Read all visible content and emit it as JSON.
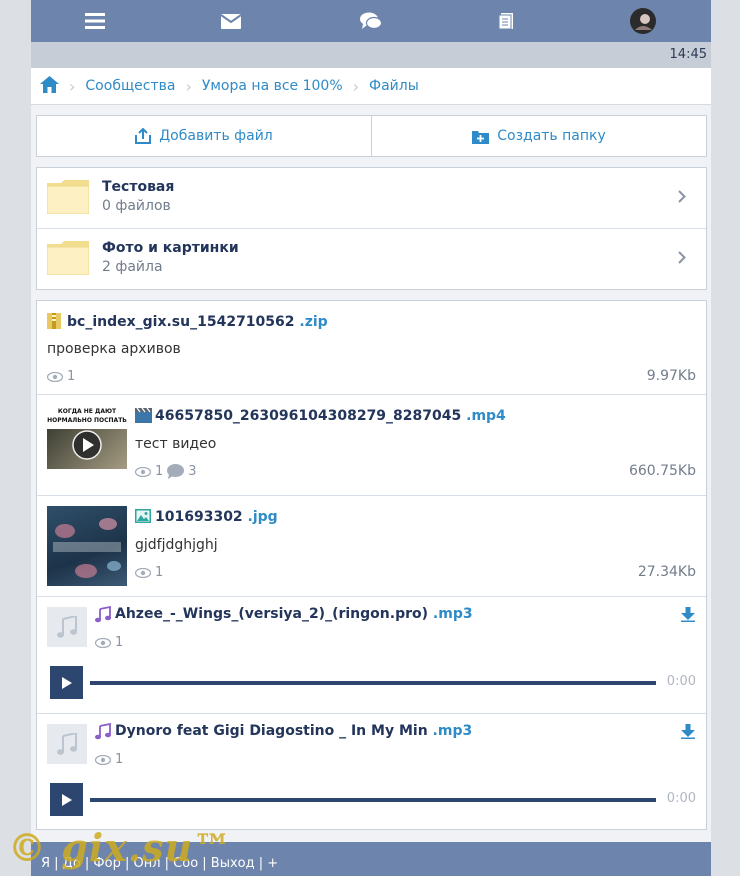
{
  "status": {
    "time": "14:45"
  },
  "nav": {
    "icons": [
      "menu-icon",
      "mail-icon",
      "chat-icon",
      "documents-icon",
      "avatar"
    ]
  },
  "breadcrumb": {
    "items": [
      "Сообщества",
      "Умора на все 100%",
      "Файлы"
    ]
  },
  "actions": {
    "add_file": "Добавить файл",
    "create_folder": "Создать папку"
  },
  "folders": [
    {
      "name": "Тестовая",
      "count": "0 файлов"
    },
    {
      "name": "Фото и картинки",
      "count": "2 файла"
    }
  ],
  "files": [
    {
      "name": "bc_index_gix.su_1542710562",
      "ext": ".zip",
      "desc": "проверка архивов",
      "views": "1",
      "size": "9.97Kb"
    },
    {
      "name": "46657850_263096104308279_8287045",
      "ext": ".mp4",
      "desc": "тест видео",
      "views": "1",
      "comments": "3",
      "size": "660.75Kb",
      "thumb_text": "КОГДА НЕ ДАЮТ НОРМАЛЬНО ПОСПАТЬ"
    },
    {
      "name": "101693302",
      "ext": ".jpg",
      "desc": "gjdfjdghjghj",
      "views": "1",
      "size": "27.34Kb"
    },
    {
      "name": "Ahzee_-_Wings_(versiya_2)_(ringon.pro)",
      "ext": ".mp3",
      "views": "1",
      "time": "0:00"
    },
    {
      "name": "Dynoro feat Gigi Diagostino _ In My Min",
      "ext": ".mp3",
      "views": "1",
      "time": "0:00"
    }
  ],
  "footer": {
    "links": "Я | До | Фор | Онл | Соо | Выход | +"
  },
  "watermark": {
    "text": "© gix.su™"
  },
  "colors": {
    "header": "#6d84ad",
    "accent": "#2f8bc7",
    "dark": "#2d4670"
  }
}
